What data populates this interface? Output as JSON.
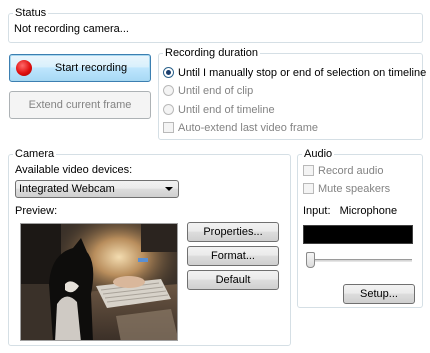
{
  "status": {
    "title": "Status",
    "text": "Not recording camera..."
  },
  "recording": {
    "start_button": "Start recording",
    "extend_button": "Extend current frame"
  },
  "duration": {
    "title": "Recording duration",
    "options": [
      {
        "label": "Until I manually stop or end of selection on timeline",
        "selected": true,
        "enabled": true
      },
      {
        "label": "Until end of clip",
        "selected": false,
        "enabled": false
      },
      {
        "label": "Until end of timeline",
        "selected": false,
        "enabled": false
      }
    ],
    "auto_extend": {
      "label": "Auto-extend last video frame",
      "checked": false,
      "enabled": false
    }
  },
  "camera": {
    "title": "Camera",
    "devices_label": "Available video devices:",
    "selected_device": "Integrated Webcam",
    "preview_label": "Preview:",
    "buttons": {
      "properties": "Properties...",
      "format": "Format...",
      "default": "Default"
    }
  },
  "audio": {
    "title": "Audio",
    "record_audio": {
      "label": "Record audio",
      "checked": false
    },
    "mute_speakers": {
      "label": "Mute speakers",
      "checked": false
    },
    "input_label": "Input:",
    "input_value": "Microphone",
    "setup_button": "Setup..."
  },
  "colors": {
    "focus_border": "#3c7fb1",
    "record_red": "#e01010",
    "disabled_text": "#838383"
  }
}
